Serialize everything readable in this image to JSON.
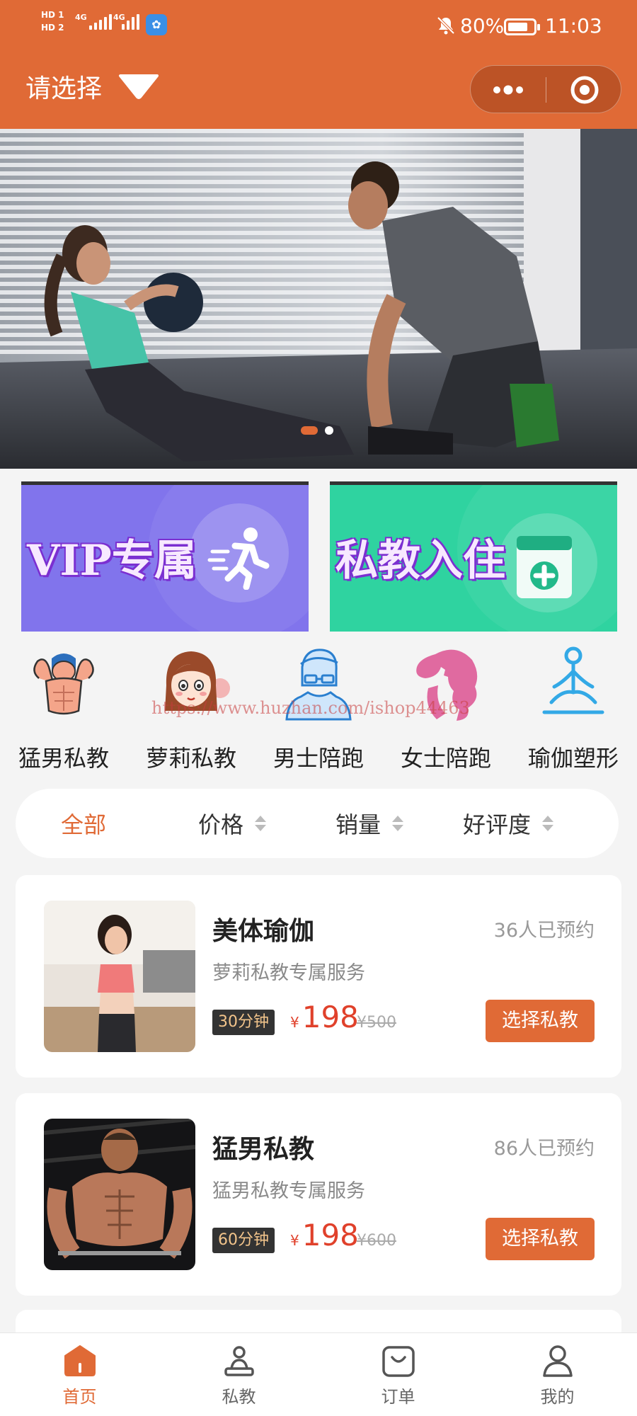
{
  "status_bar": {
    "sim1": "HD 1",
    "sim2": "HD 2",
    "net1": "4G",
    "net2": "4G",
    "battery_percent": "80%",
    "battery_level": 0.8,
    "time": "11:03",
    "icons": [
      "signal-icon",
      "app-badge-icon",
      "bell-muted-icon",
      "battery-icon"
    ]
  },
  "header": {
    "picker_label": "请选择",
    "picker_icon": "triangle-down-icon",
    "capsule_icons": [
      "more-dots-icon",
      "target-icon"
    ]
  },
  "banner": {
    "slide_count": 2,
    "active_slide": 1
  },
  "promos": [
    {
      "title": "VIP专属",
      "icon": "runner-icon",
      "color": "#8174ec"
    },
    {
      "title": "私教入住",
      "icon": "medkit-icon",
      "color": "#2fd3a0"
    }
  ],
  "categories": [
    {
      "label": "猛男私教",
      "icon": "muscle-man-icon"
    },
    {
      "label": "萝莉私教",
      "icon": "girl-face-icon"
    },
    {
      "label": "男士陪跑",
      "icon": "man-glasses-icon"
    },
    {
      "label": "女士陪跑",
      "icon": "woman-silhouette-icon"
    },
    {
      "label": "瑜伽塑形",
      "icon": "yoga-icon"
    }
  ],
  "watermark": "https://www.huzhan.com/ishop44463",
  "sort": [
    {
      "label": "全部",
      "active": true
    },
    {
      "label": "价格",
      "active": false
    },
    {
      "label": "销量",
      "active": false
    },
    {
      "label": "好评度",
      "active": false
    }
  ],
  "products": [
    {
      "name": "美体瑜伽",
      "booked": "36人已预约",
      "desc": "萝莉私教专属服务",
      "duration": "30分钟",
      "currency": "¥",
      "price": "198",
      "original_price": "¥500",
      "button": "选择私教"
    },
    {
      "name": "猛男私教",
      "booked": "86人已预约",
      "desc": "猛男私教专属服务",
      "duration": "60分钟",
      "currency": "¥",
      "price": "198",
      "original_price": "¥600",
      "button": "选择私教"
    }
  ],
  "tabs": [
    {
      "label": "首页",
      "icon": "home-icon",
      "active": true
    },
    {
      "label": "私教",
      "icon": "coach-icon",
      "active": false
    },
    {
      "label": "订单",
      "icon": "order-bag-icon",
      "active": false
    },
    {
      "label": "我的",
      "icon": "user-icon",
      "active": false
    }
  ],
  "colors": {
    "accent": "#e06a36",
    "price": "#e0412b",
    "background": "#f4f4f4"
  }
}
